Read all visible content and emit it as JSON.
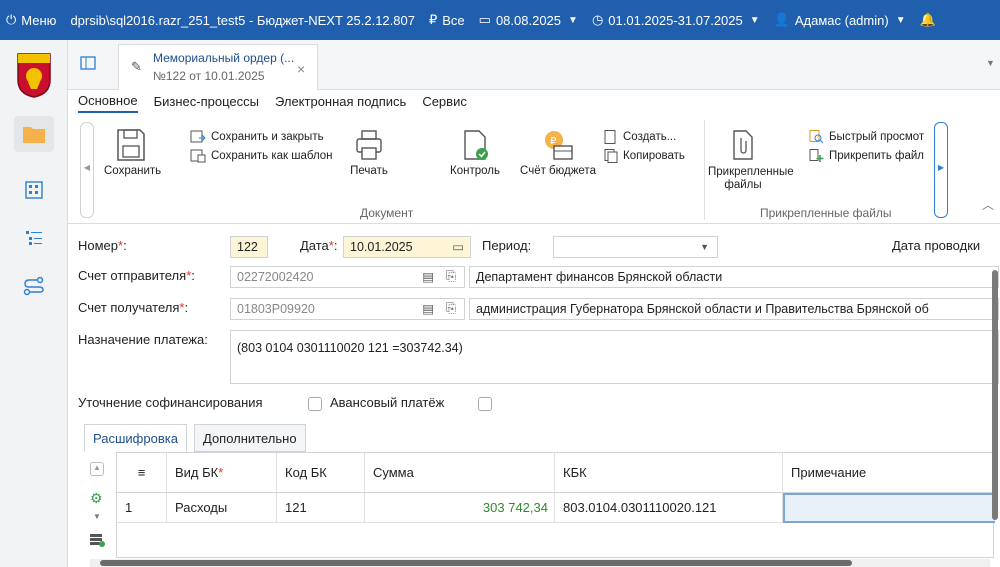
{
  "topbar": {
    "menu": "Меню",
    "connection": "dprsib\\sql2016.razr_251_test5 - Бюджет-NEXT 25.2.12.807",
    "filter": "Все",
    "date": "08.08.2025",
    "period": "01.01.2025-31.07.2025",
    "user": "Адамас (admin)"
  },
  "doc_tab": {
    "title": "Мемориальный ордер (...",
    "subtitle": "№122 от 10.01.2025"
  },
  "ribbon_tabs": [
    "Основное",
    "Бизнес-процессы",
    "Электронная подпись",
    "Сервис"
  ],
  "ribbon": {
    "save": "Сохранить",
    "save_close": "Сохранить и закрыть",
    "save_template": "Сохранить как шаблон",
    "print": "Печать",
    "control": "Контроль",
    "budget_account": "Счёт бюджета",
    "create": "Создать...",
    "copy": "Копировать",
    "attached_files_btn": "Прикрепленные файлы",
    "quick_view": "Быстрый просмот",
    "attach_file": "Прикрепить файл",
    "group_document": "Документ",
    "group_files": "Прикрепленные файлы"
  },
  "form": {
    "number_label": "Номер",
    "number_value": "122",
    "date_label": "Дата",
    "date_value": "10.01.2025",
    "period_label": "Период:",
    "period_value": "",
    "posting_date_label": "Дата проводки",
    "sender_label": "Счет отправителя",
    "sender_account": "02272002420",
    "sender_name": "Департамент финансов Брянской области",
    "receiver_label": "Счет получателя",
    "receiver_account": "01803P09920",
    "receiver_name": "администрация Губернатора Брянской области и Правительства Брянской об",
    "purpose_label": "Назначение платежа:",
    "purpose_value": "(803 0104 0301110020 121 =303742.34)",
    "cofinancing_label": "Уточнение софинансирования",
    "advance_label": "Авансовый платёж"
  },
  "bottom_tabs": [
    "Расшифровка",
    "Дополнительно"
  ],
  "grid": {
    "columns": [
      "Вид БК",
      "Код БК",
      "Сумма",
      "КБК",
      "Примечание"
    ],
    "rows": [
      {
        "num": "1",
        "vid_bk": "Расходы",
        "kod_bk": "121",
        "summa": "303 742,34",
        "kbk": "803.0104.0301110020.121",
        "note": ""
      }
    ]
  },
  "colors": {
    "topbar": "#1f5fae",
    "required": "#d33333",
    "sum_green": "#2e8b2e",
    "yellow_field": "#fdf5d6"
  }
}
